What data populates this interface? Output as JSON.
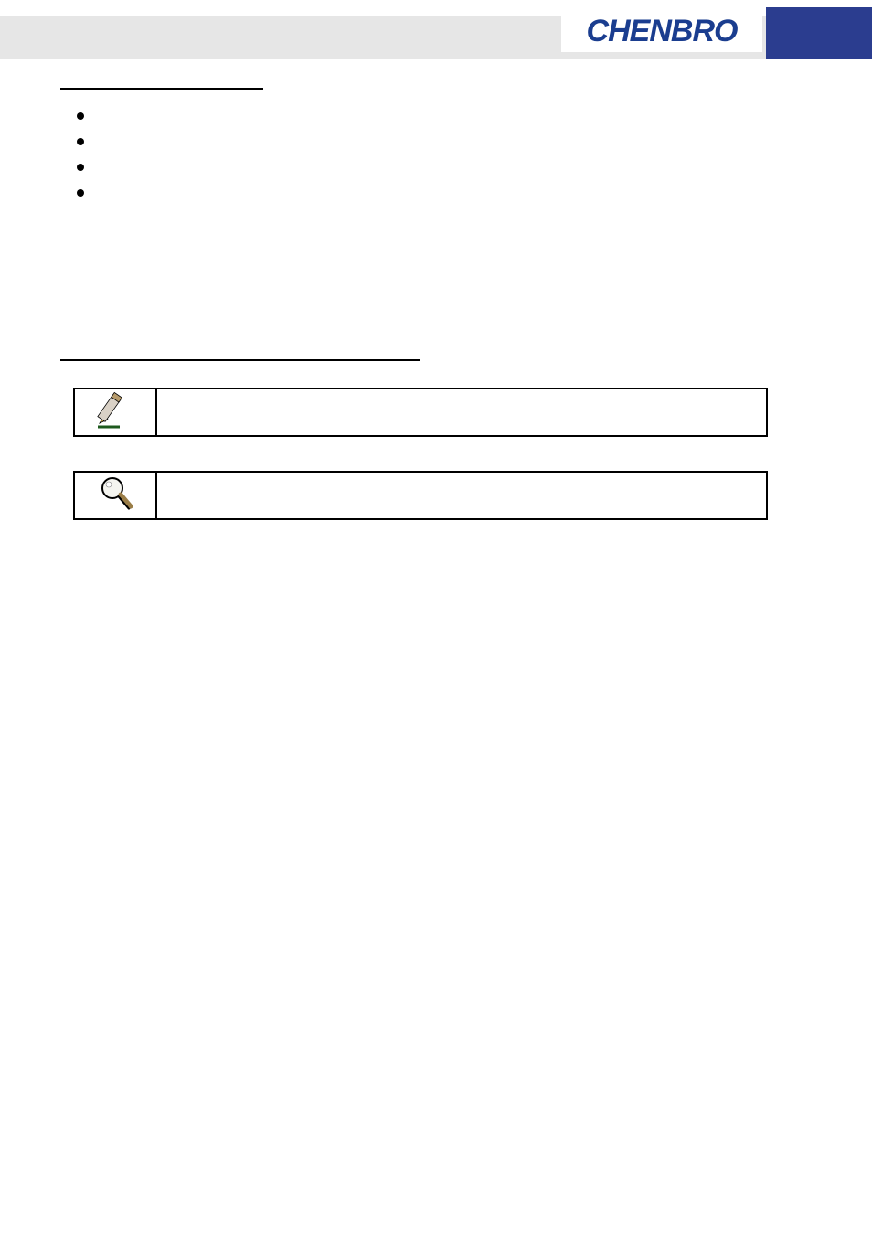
{
  "header": {
    "logo_text": "CHENBRO"
  },
  "sections": {
    "heading1_text": "",
    "bullets": [
      "",
      "",
      "",
      ""
    ],
    "heading2_text": ""
  },
  "callouts": [
    {
      "icon": "note-pencil-icon",
      "text": ""
    },
    {
      "icon": "magnifier-icon",
      "text": ""
    }
  ]
}
